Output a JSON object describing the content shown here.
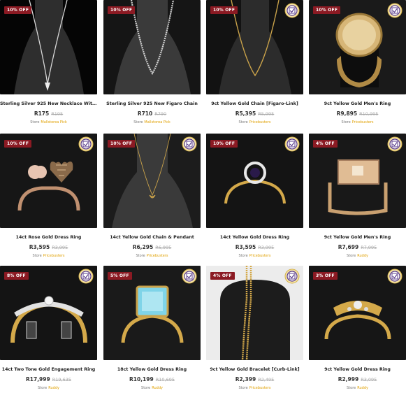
{
  "products": [
    {
      "discount": "10% OFF",
      "title": "Sterling Silver 925 New Necklace With...",
      "price": "R175",
      "was": "R195",
      "store_label": "Store",
      "store": "Mallstorea Pick",
      "verified": false,
      "image": "silver-necklace-on-bust"
    },
    {
      "discount": "10% OFF",
      "title": "Sterling Silver 925 New Figaro Chain",
      "price": "R710",
      "was": "R790",
      "store_label": "Store",
      "store": "Mallstorea Pick",
      "verified": false,
      "image": "silver-figaro-chain-on-bust"
    },
    {
      "discount": "10% OFF",
      "title": "9ct Yellow Gold Chain [Figaro-Link]",
      "price": "R5,395",
      "was": "R5,995",
      "store_label": "Store",
      "store": "Pricebusters",
      "verified": true,
      "image": "gold-chain-on-bust"
    },
    {
      "discount": "10% OFF",
      "title": "9ct Yellow Gold Men's Ring",
      "price": "R9,895",
      "was": "R10,995",
      "store_label": "Store",
      "store": "Pricebusters",
      "verified": true,
      "image": "gold-signet-ring"
    },
    {
      "discount": "10% OFF",
      "title": "14ct Rose Gold Dress Ring",
      "price": "R3,595",
      "was": "R3,995",
      "store_label": "Store",
      "store": "Pricebusters",
      "verified": true,
      "image": "rose-gold-heart-ring"
    },
    {
      "discount": "10% OFF",
      "title": "14ct Yellow Gold Chain & Pendant",
      "price": "R6,295",
      "was": "R6,995",
      "store_label": "Store",
      "store": "Pricebusters",
      "verified": true,
      "image": "gold-chain-pendant-on-bust"
    },
    {
      "discount": "10% OFF",
      "title": "14ct Yellow Gold Dress Ring",
      "price": "R3,595",
      "was": "R3,995",
      "store_label": "Store",
      "store": "Pricebusters",
      "verified": true,
      "image": "gold-halo-ring"
    },
    {
      "discount": "4% OFF",
      "title": "9ct Yellow Gold Men's Ring",
      "price": "R7,699",
      "was": "R7,995",
      "store_label": "Store",
      "store": "Ruddy",
      "verified": true,
      "image": "gold-square-mens-ring"
    },
    {
      "discount": "8% OFF",
      "title": "14ct Two Tone Gold Engagement Ring",
      "price": "R17,999",
      "was": "R19,635",
      "store_label": "Store",
      "store": "Ruddy",
      "verified": true,
      "image": "two-tone-engagement-ring"
    },
    {
      "discount": "5% OFF",
      "title": "18ct Yellow Gold Dress Ring",
      "price": "R10,199",
      "was": "R10,695",
      "store_label": "Store",
      "store": "Ruddy",
      "verified": true,
      "image": "blue-topaz-ring"
    },
    {
      "discount": "4% OFF",
      "title": "9ct Yellow Gold Bracelet [Curb-Link]",
      "price": "R2,399",
      "was": "R2,495",
      "store_label": "Store",
      "store": "Pricebusters",
      "verified": true,
      "image": "gold-curb-bracelet"
    },
    {
      "discount": "3% OFF",
      "title": "9ct Yellow Gold Dress Ring",
      "price": "R2,999",
      "was": "R3,095",
      "store_label": "Store",
      "store": "Ruddy",
      "verified": true,
      "image": "gold-diamond-dress-ring"
    }
  ],
  "colors": {
    "discount_badge": "#8b1a23",
    "store_name": "#e0a000",
    "bg_dark": "#1c1c1c",
    "gold": "#d4a94a"
  }
}
